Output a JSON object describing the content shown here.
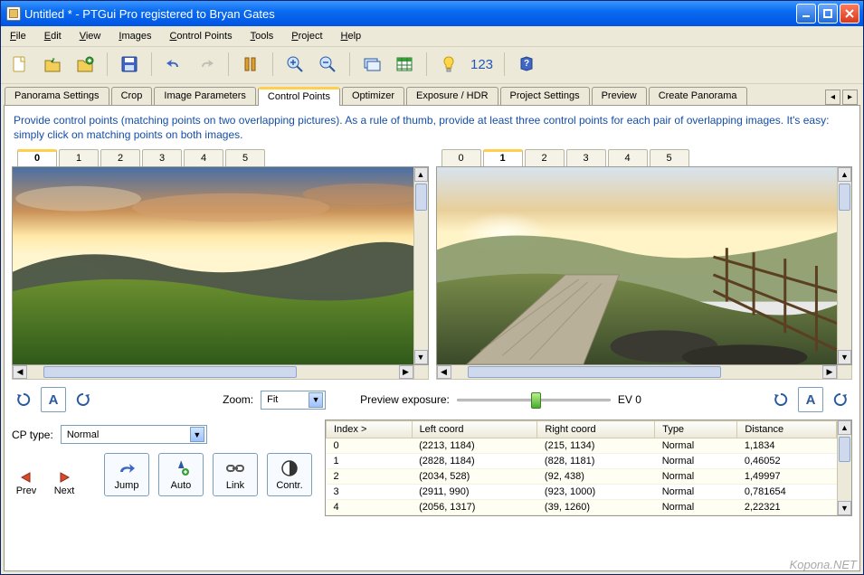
{
  "titlebar": {
    "title": "Untitled * - PTGui Pro registered to Bryan Gates"
  },
  "menubar": [
    "File",
    "Edit",
    "View",
    "Images",
    "Control Points",
    "Tools",
    "Project",
    "Help"
  ],
  "toolbar_123": "123",
  "maintabs": {
    "items": [
      "Panorama Settings",
      "Crop",
      "Image Parameters",
      "Control Points",
      "Optimizer",
      "Exposure / HDR",
      "Project Settings",
      "Preview",
      "Create Panorama"
    ],
    "active": 3
  },
  "instructions": "Provide control points (matching points on two overlapping pictures). As a rule of thumb, provide at least three control points for each pair of overlapping images. It's easy: simply click on matching points on both images.",
  "leftpane": {
    "tabs": [
      "0",
      "1",
      "2",
      "3",
      "4",
      "5"
    ],
    "active": 0
  },
  "rightpane": {
    "tabs": [
      "0",
      "1",
      "2",
      "3",
      "4",
      "5"
    ],
    "active": 1
  },
  "mid": {
    "zoom_label": "Zoom:",
    "zoom_value": "Fit",
    "preview_label": "Preview exposure:",
    "preview_readout": "EV 0",
    "A": "A"
  },
  "cp": {
    "label": "CP type:",
    "value": "Normal",
    "prev": "Prev",
    "next": "Next",
    "jump": "Jump",
    "auto": "Auto",
    "link": "Link",
    "contr": "Contr."
  },
  "table": {
    "cols": [
      "Index >",
      "Left coord",
      "Right coord",
      "Type",
      "Distance"
    ],
    "rows": [
      {
        "idx": "0",
        "left": "(2213, 1184)",
        "right": "(215, 1134)",
        "type": "Normal",
        "dist": "1,1834"
      },
      {
        "idx": "1",
        "left": "(2828, 1184)",
        "right": "(828, 1181)",
        "type": "Normal",
        "dist": "0,46052"
      },
      {
        "idx": "2",
        "left": "(2034, 528)",
        "right": "(92, 438)",
        "type": "Normal",
        "dist": "1,49997"
      },
      {
        "idx": "3",
        "left": "(2911, 990)",
        "right": "(923, 1000)",
        "type": "Normal",
        "dist": "0,781654"
      },
      {
        "idx": "4",
        "left": "(2056, 1317)",
        "right": "(39, 1260)",
        "type": "Normal",
        "dist": "2,22321"
      }
    ]
  },
  "watermark": "Kopona.NET"
}
